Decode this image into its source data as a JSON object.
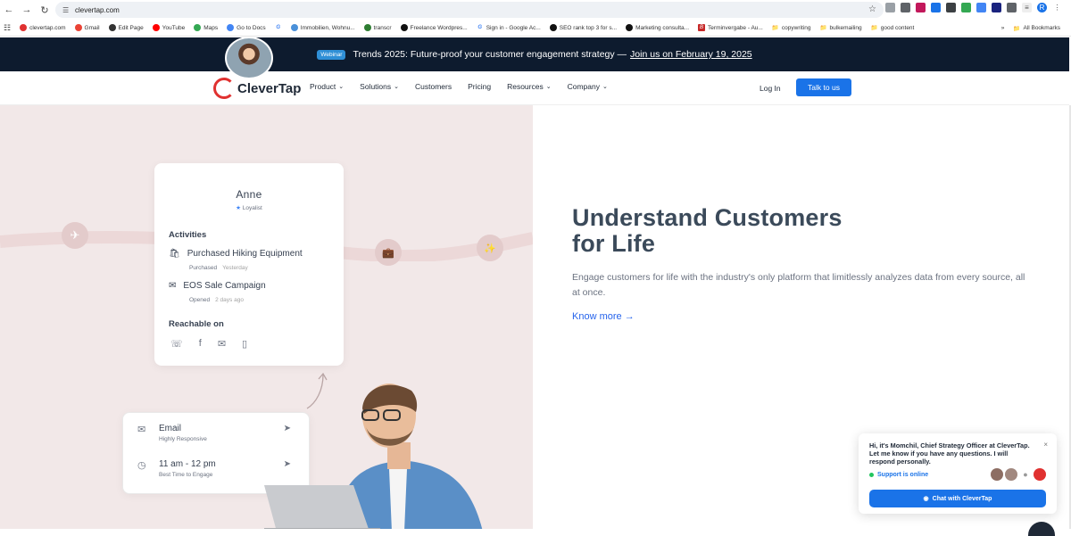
{
  "browser": {
    "url": "clevertap.com",
    "bookmarks": [
      "clevertap.com",
      "Gmail",
      "Edit Page",
      "YouTube",
      "Maps",
      "Go to Docs",
      "Immobilien, Wohnu...",
      "transcr",
      "Freelance Wordpres...",
      "Sign in - Google Ac...",
      "SEO rank top 3 for s...",
      "Marketing consulta...",
      "Terminvergabe - Au...",
      "copywriting",
      "bulkemailing",
      "good content"
    ],
    "all_bookmarks": "All Bookmarks",
    "profile_initial": "R"
  },
  "banner": {
    "badge": "Webinar",
    "text": "Trends 2025: Future-proof your customer engagement strategy —",
    "link": "Join us on February 19, 2025"
  },
  "header": {
    "logo": "CleverTap",
    "nav": [
      "Product",
      "Solutions",
      "Customers",
      "Pricing",
      "Resources",
      "Company"
    ],
    "login": "Log In",
    "cta": "Talk to us"
  },
  "profile_card": {
    "name": "Anne",
    "tier": "Loyalist",
    "activities_heading": "Activities",
    "activities": [
      {
        "title": "Purchased Hiking Equipment",
        "status": "Purchased",
        "time": "Yesterday"
      },
      {
        "title": "EOS Sale Campaign",
        "status": "Opened",
        "time": "2 days ago"
      }
    ],
    "reachable_heading": "Reachable on"
  },
  "channel_card": {
    "rows": [
      {
        "title": "Email",
        "subtitle": "Highly Responsive"
      },
      {
        "title": "11 am - 12 pm",
        "subtitle": "Best Time to Engage"
      }
    ]
  },
  "hero": {
    "headline_line1": "Understand Customers",
    "headline_line2": "for Life",
    "subtext": "Engage customers for life with the industry's only platform that limitlessly analyzes data from every source, all at once.",
    "link": "Know more"
  },
  "chat": {
    "message": "Hi, it's Momchil, Chief Strategy Officer at CleverTap. Let me know if you have any questions. I will respond personally.",
    "status": "Support is online",
    "button": "Chat with CleverTap"
  }
}
